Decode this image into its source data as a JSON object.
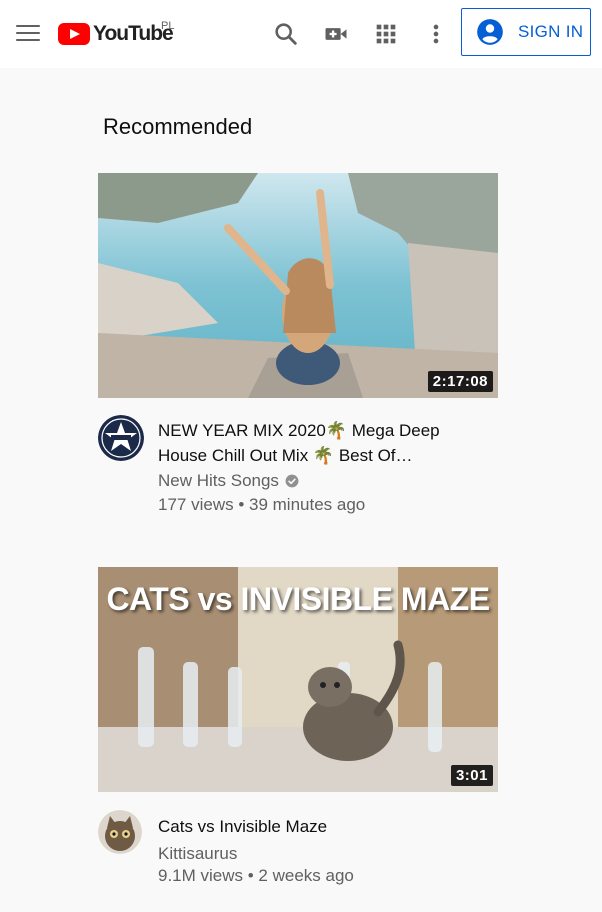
{
  "header": {
    "logo_text": "YouTube",
    "country_code": "PL",
    "signin_label": "SIGN IN",
    "icons": [
      "menu-icon",
      "search-icon",
      "create-video-icon",
      "apps-grid-icon",
      "more-vert-icon",
      "account-circle-icon"
    ]
  },
  "colors": {
    "brand_red": "#ff0000",
    "link_blue": "#065fd4",
    "secondary_text": "#606060"
  },
  "section_title": "Recommended",
  "videos": [
    {
      "title_line1": "NEW YEAR MIX 2020🌴 Mega Deep",
      "title_line2": "House Chill Out Mix 🌴 Best Of…",
      "duration": "2:17:08",
      "channel": "New Hits Songs",
      "verified": true,
      "views": "177 views",
      "age": "39 minutes ago",
      "stats": "177 views • 39 minutes ago"
    },
    {
      "title_line1": "Cats vs Invisible Maze",
      "title_line2": "",
      "duration": "3:01",
      "thumbnail_caption": "CATS vs INVISIBLE MAZE",
      "channel": "Kittisaurus",
      "verified": false,
      "views": "9.1M views",
      "age": "2 weeks ago",
      "stats": "9.1M views • 2 weeks ago"
    }
  ]
}
